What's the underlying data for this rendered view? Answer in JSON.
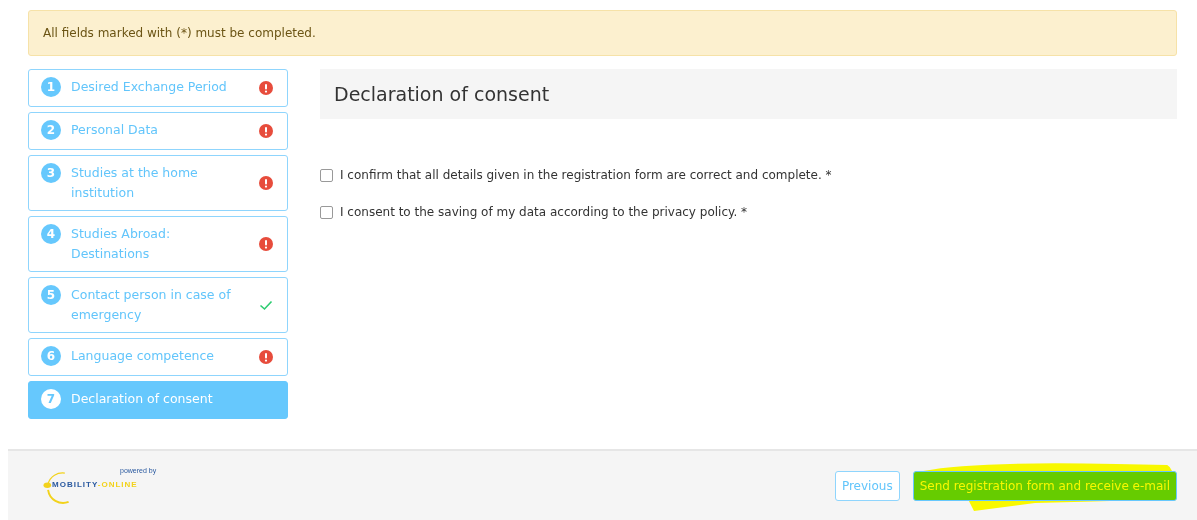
{
  "notice": "All fields marked with (*) must be completed.",
  "steps": [
    {
      "number": "1",
      "label": "Desired Exchange Period",
      "kind": "error",
      "selected": false
    },
    {
      "number": "2",
      "label": "Personal Data",
      "kind": "error",
      "selected": false
    },
    {
      "number": "3",
      "label": "Studies at the home institution",
      "kind": "error",
      "selected": false
    },
    {
      "number": "4",
      "label": "Studies Abroad: Destinations",
      "kind": "error",
      "selected": false
    },
    {
      "number": "5",
      "label": "Contact person in case of emergency",
      "kind": "complete",
      "selected": false
    },
    {
      "number": "6",
      "label": "Language competence",
      "kind": "error",
      "selected": false
    },
    {
      "number": "7",
      "label": "Declaration of consent",
      "kind": "current",
      "selected": true
    }
  ],
  "section": {
    "title": "Declaration of consent"
  },
  "checkboxes": [
    {
      "label": "I confirm that all details given in the registration form are correct and complete. *",
      "checked": false
    },
    {
      "label": "I consent to the saving of my data according to the privacy policy. *",
      "checked": false
    }
  ],
  "footer": {
    "powered_by": "powered by",
    "logo_left": "MOBILITY",
    "logo_right": "-ONLINE",
    "buttons": [
      {
        "label": "Previous",
        "kind": "secondary"
      },
      {
        "label": "Send registration form and receive e-mail",
        "kind": "primary",
        "highlighted": true
      }
    ]
  }
}
